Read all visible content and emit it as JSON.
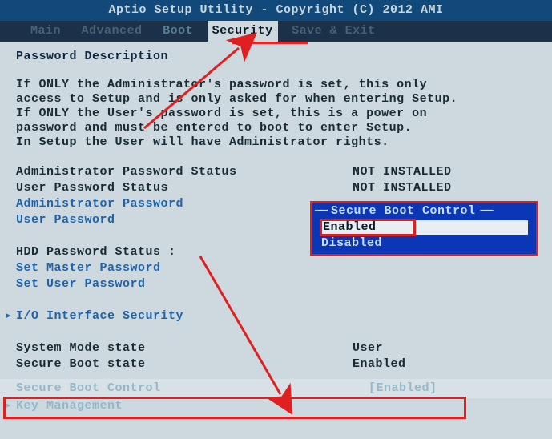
{
  "titlebar": "Aptio Setup Utility - Copyright (C) 2012 AMI",
  "tabs": {
    "main": "Main",
    "advanced": "Advanced",
    "boot": "Boot",
    "security": "Security",
    "save_exit": "Save & Exit"
  },
  "heading": "Password Description",
  "paragraph": "If ONLY the Administrator's password is set, this only\naccess to Setup and is only asked for when entering Setup.\nIf ONLY the User's password is set, this is a power on\npassword and must be entered to boot to enter Setup.\nIn Setup the User will have Administrator rights.",
  "rows": {
    "admin_pw_status_label": "Administrator Password Status",
    "admin_pw_status_value": "NOT INSTALLED",
    "user_pw_status_label": "User Password Status",
    "user_pw_status_value": "NOT INSTALLED",
    "admin_pw_label": "Administrator Password",
    "user_pw_label": "User Password",
    "hdd_pw_status_label": "HDD Password Status   :",
    "set_master_pw_label": "Set Master Password",
    "set_user_pw_label": "Set User Password",
    "io_sec_label": "I/O Interface Security",
    "sys_mode_label": "System Mode state",
    "sys_mode_value": "User",
    "sb_state_label": "Secure Boot state",
    "sb_state_value": "Enabled",
    "sb_control_label": "Secure Boot Control",
    "sb_control_value": "[Enabled]",
    "key_mgmt_label": "Key Management"
  },
  "popup": {
    "title": "Secure Boot Control",
    "opt_enabled": "Enabled",
    "opt_disabled": "Disabled"
  }
}
